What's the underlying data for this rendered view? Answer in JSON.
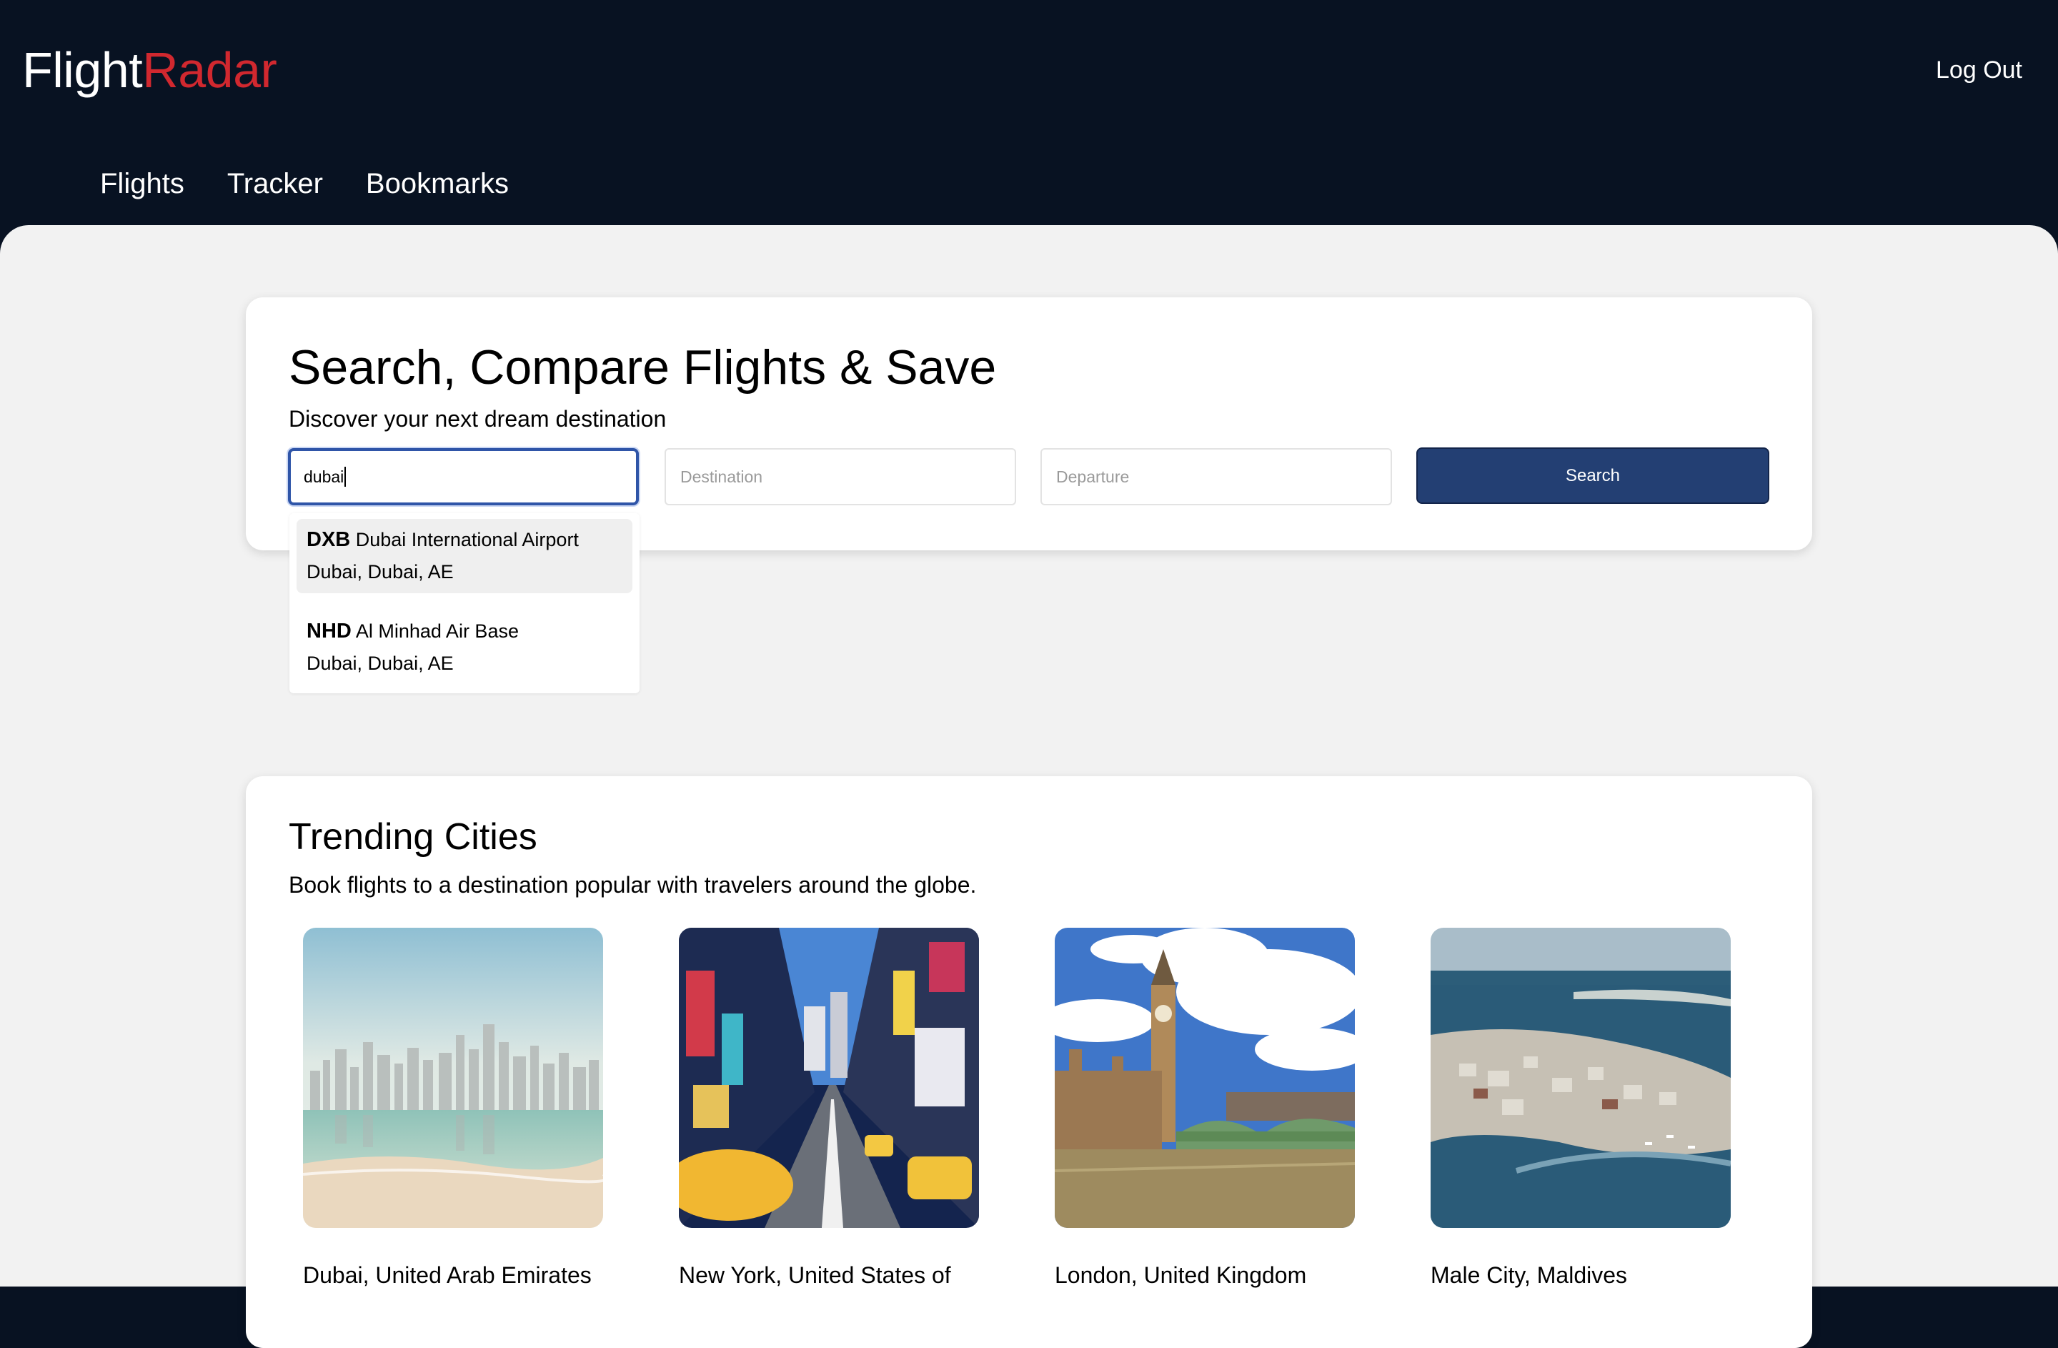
{
  "header": {
    "logo_part1": "Flight",
    "logo_part2": "Radar",
    "logout_label": "Log Out",
    "nav": [
      "Flights",
      "Tracker",
      "Bookmarks"
    ]
  },
  "search": {
    "title": "Search, Compare Flights & Save",
    "subtitle": "Discover your next dream destination",
    "origin_value": "dubai",
    "destination_placeholder": "Destination",
    "departure_placeholder": "Departure",
    "button_label": "Search",
    "suggestions": [
      {
        "code": "DXB",
        "name": "Dubai International Airport",
        "location": "Dubai, Dubai, AE"
      },
      {
        "code": "NHD",
        "name": "Al Minhad Air Base",
        "location": "Dubai, Dubai, AE"
      }
    ]
  },
  "trending": {
    "title": "Trending Cities",
    "subtitle": "Book flights to a destination popular with travelers around the globe.",
    "cities": [
      {
        "name": "Dubai, United Arab Emirates"
      },
      {
        "name": "New York, United States of"
      },
      {
        "name": "London, United Kingdom"
      },
      {
        "name": "Male City, Maldives"
      }
    ]
  },
  "colors": {
    "header_bg": "#081222",
    "logo_accent": "#d1282f",
    "button_bg": "#233f73",
    "page_bg": "#f2f2f2"
  }
}
